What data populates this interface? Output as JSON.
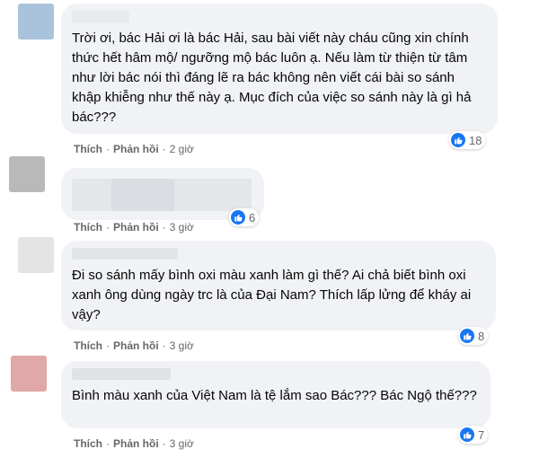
{
  "actions": {
    "like": "Thích",
    "reply": "Phản hồi",
    "dot": "·"
  },
  "comments": [
    {
      "avatar_color": "#a9c3dc",
      "text": "Trời ơi, bác Hải ơi là bác Hải, sau bài viết này cháu cũng xin chính thức hết hâm mộ/ ngưỡng mộ bác luôn ạ. Nếu làm từ thiện từ tâm như lời bác nói thì đáng lẽ ra bác không nên viết cái bài so sánh khập khiễng như thế này ạ. Mục đích của việc so sánh này là gì hả bác???",
      "time": "2 giờ",
      "reaction_count": "18"
    },
    {
      "avatar_color": "#b9b9b9",
      "text": "",
      "time": "3 giờ",
      "reaction_count": "6"
    },
    {
      "avatar_color": "#e4e4e4",
      "text": "Đi so sánh mấy bình oxi màu xanh làm gì thế? Ai chả biết bình oxi xanh ông dùng ngày trc là của Đại Nam? Thích lấp lửng để kháy ai vậy?",
      "time": "3 giờ",
      "reaction_count": "8"
    },
    {
      "avatar_color": "#e0a8a6",
      "text": "Bình màu xanh của Việt Nam là tệ lắm sao Bác??? Bác Ngộ thế???",
      "time": "3 giờ",
      "reaction_count": "7"
    }
  ],
  "colors": {
    "like_blue": "#1877f2",
    "bubble": "#f0f2f5",
    "meta": "#65676b"
  }
}
